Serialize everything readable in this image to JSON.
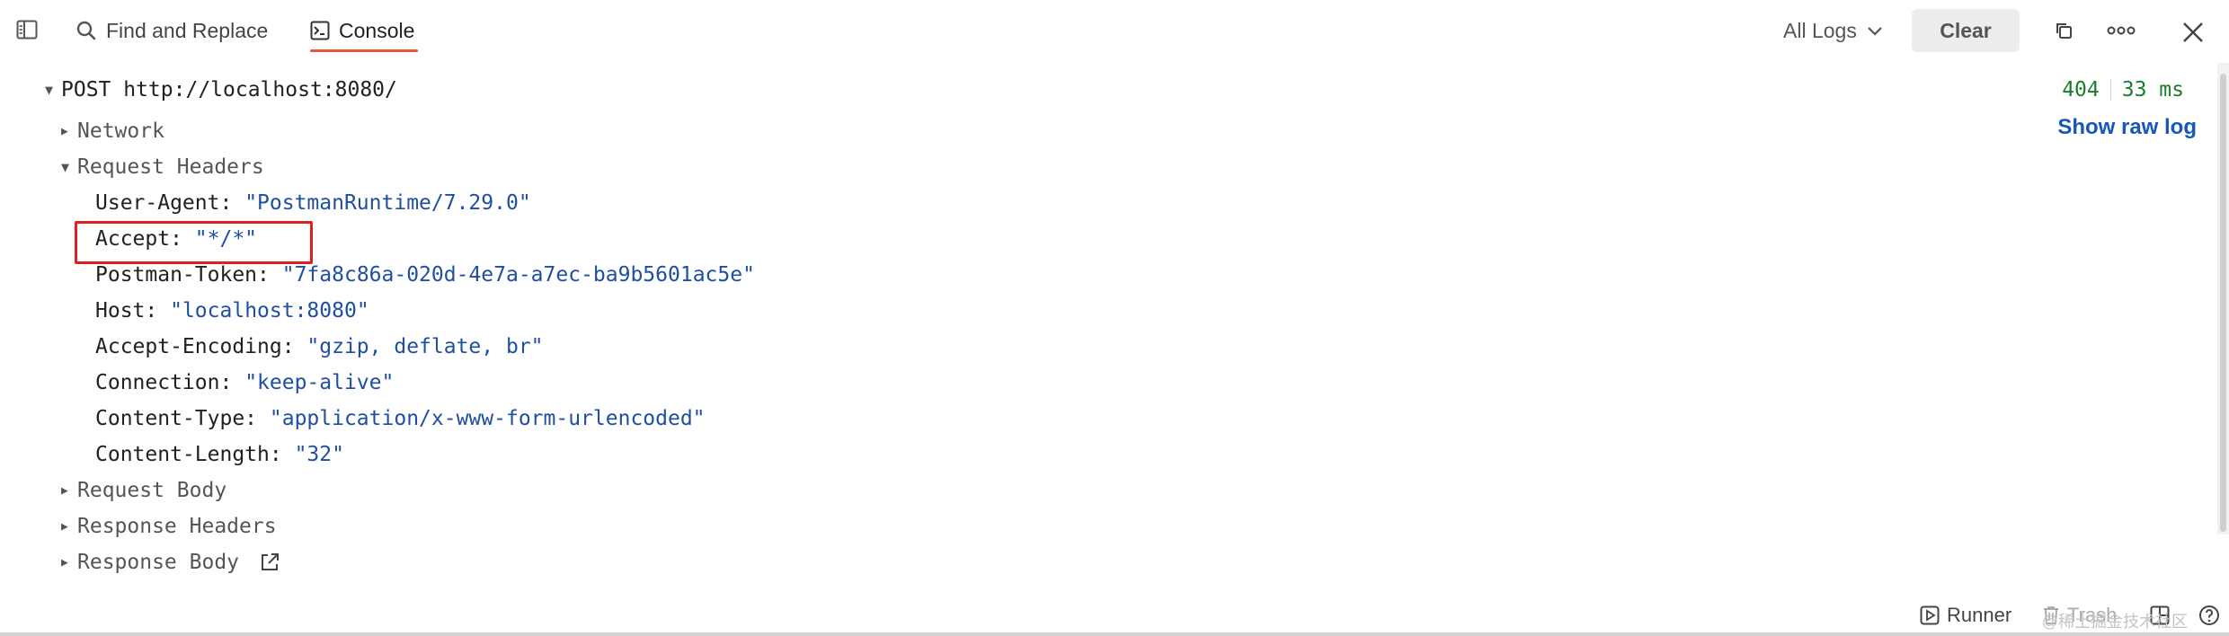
{
  "toolbar": {
    "find_replace_label": "Find and Replace",
    "console_label": "Console",
    "logs_filter_value": "All Logs",
    "clear_label": "Clear"
  },
  "request": {
    "method_url": "POST http://localhost:8080/",
    "status_code": "404",
    "duration": "33 ms",
    "show_raw_log": "Show raw log",
    "sections": {
      "network": "Network",
      "request_headers": "Request Headers",
      "request_body": "Request Body",
      "response_headers": "Response Headers",
      "response_body": "Response Body"
    },
    "headers": [
      {
        "key": "User-Agent:",
        "value": "\"PostmanRuntime/7.29.0\""
      },
      {
        "key": "Accept:",
        "value": "\"*/*\""
      },
      {
        "key": "Postman-Token:",
        "value": "\"7fa8c86a-020d-4e7a-a7ec-ba9b5601ac5e\""
      },
      {
        "key": "Host:",
        "value": "\"localhost:8080\""
      },
      {
        "key": "Accept-Encoding:",
        "value": "\"gzip, deflate, br\""
      },
      {
        "key": "Connection:",
        "value": "\"keep-alive\""
      },
      {
        "key": "Content-Type:",
        "value": "\"application/x-www-form-urlencoded\""
      },
      {
        "key": "Content-Length:",
        "value": "\"32\""
      }
    ]
  },
  "bottom": {
    "runner_label": "Runner",
    "trash_label": "Trash",
    "watermark": "@稀土掘金技术社区"
  },
  "colors": {
    "accent_tab": "#e8563a",
    "status_ok_green": "#1c7d2b",
    "header_value_blue": "#1f4ea3",
    "link_blue": "#1657b8",
    "highlight_red": "#e02020"
  },
  "icons": [
    "sidebar-toggle-icon",
    "search-icon",
    "console-icon",
    "chevron-down-icon",
    "copy-icon",
    "more-icon",
    "close-icon",
    "external-link-icon",
    "runner-icon",
    "trash-icon",
    "layout-icon",
    "help-icon"
  ]
}
